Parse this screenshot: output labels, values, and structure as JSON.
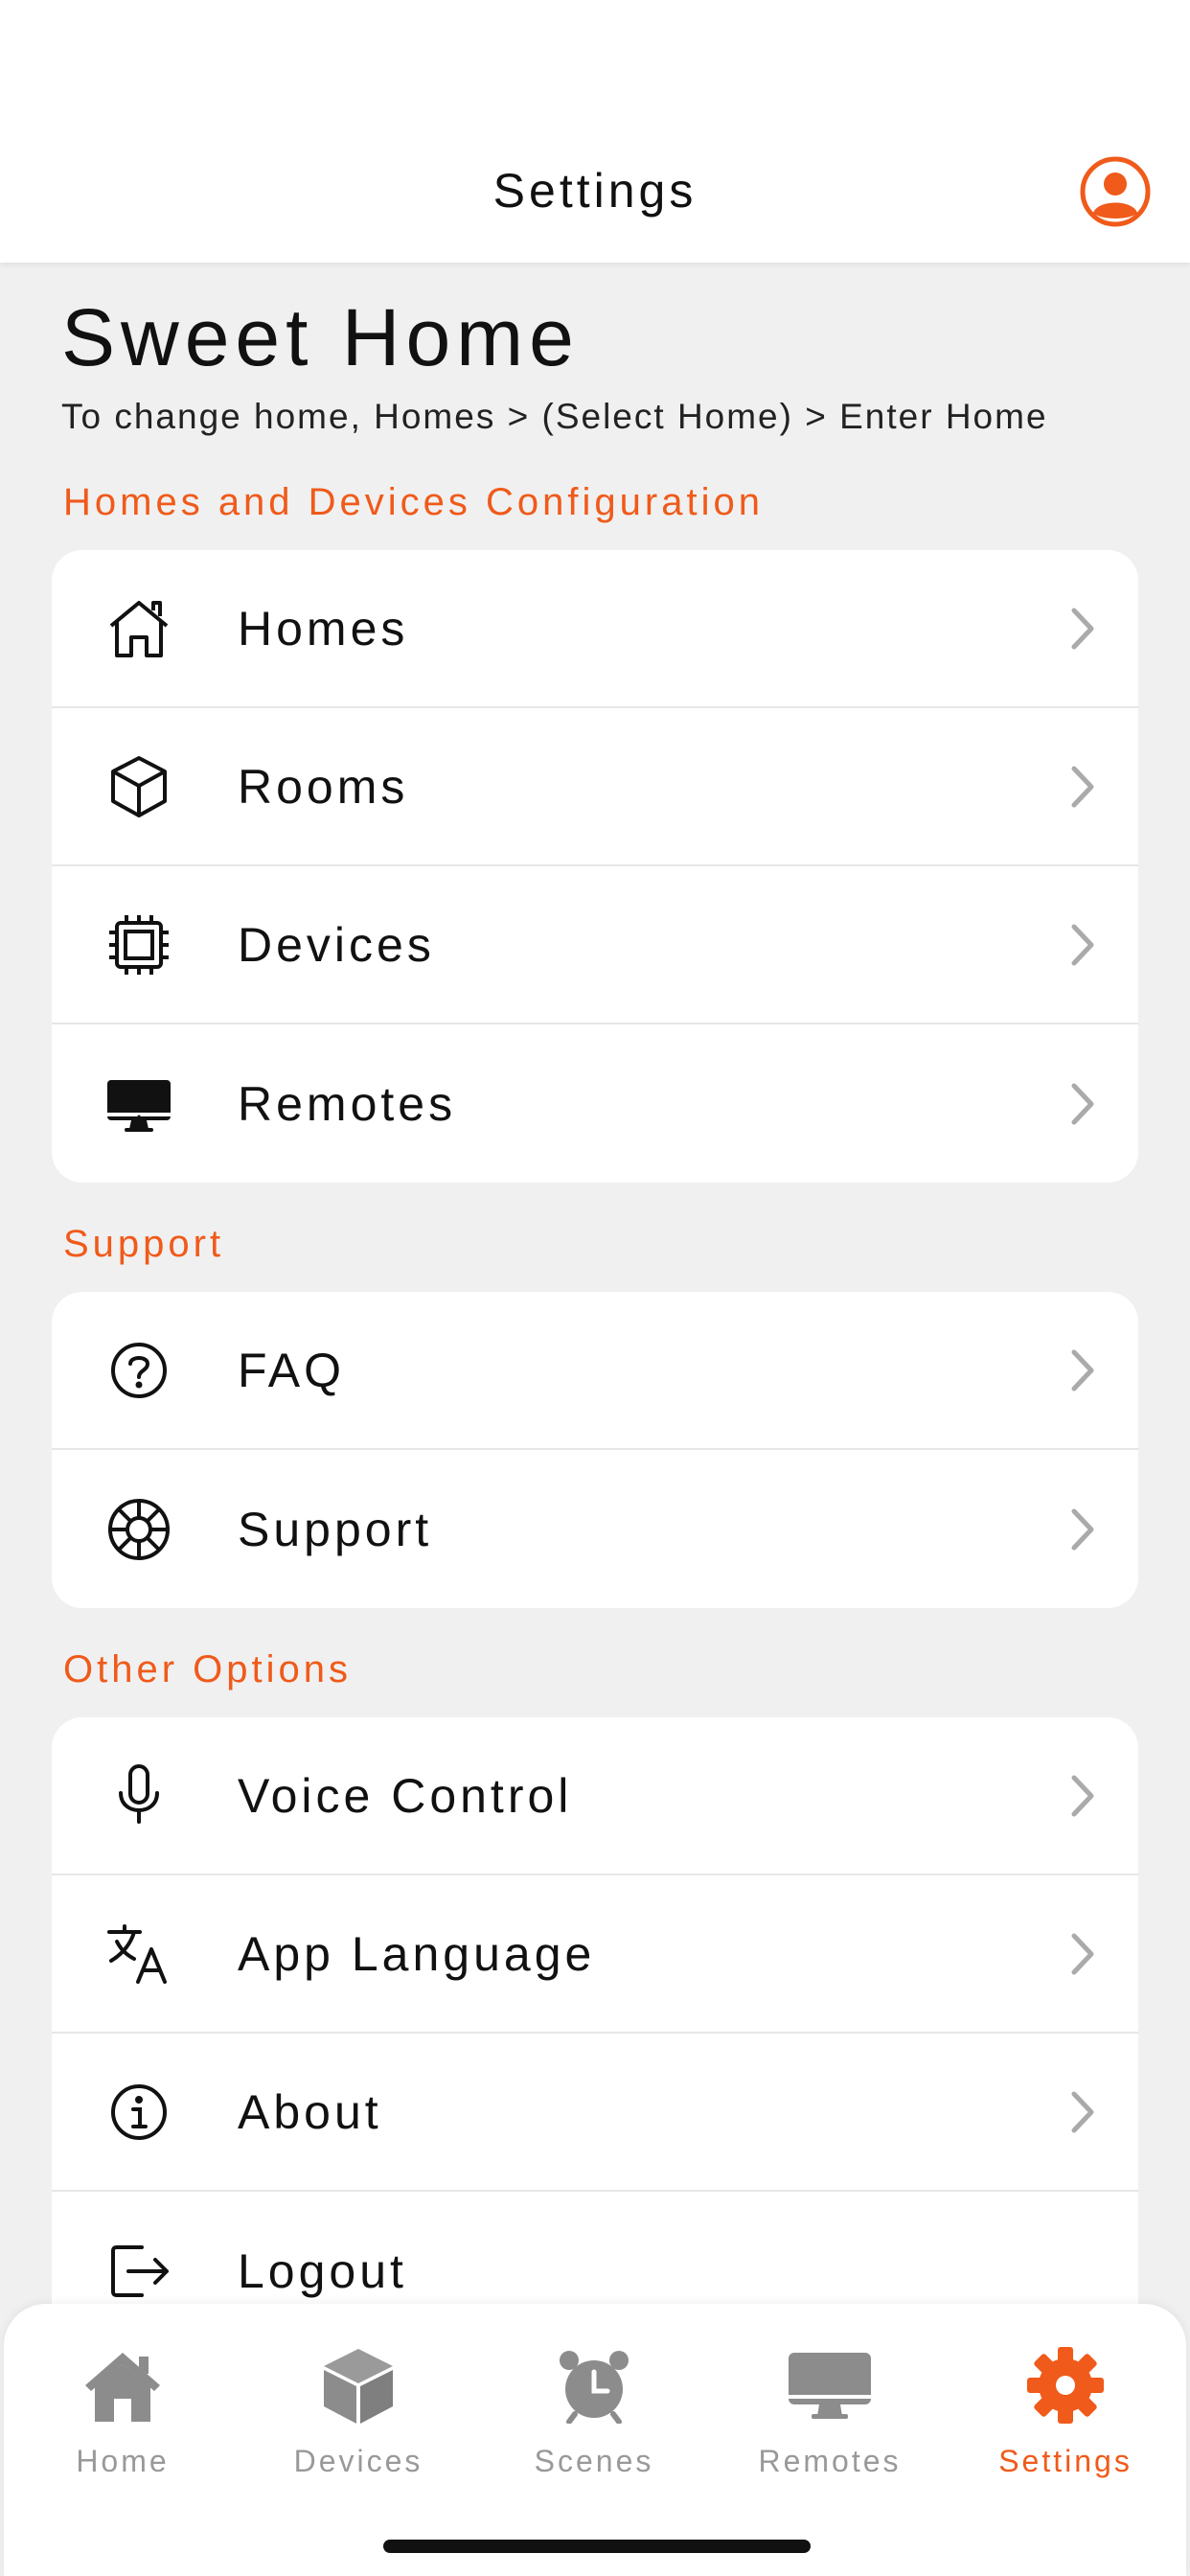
{
  "header": {
    "title": "Settings"
  },
  "home": {
    "name": "Sweet Home",
    "hint": "To change home, Homes > (Select Home) > Enter Home"
  },
  "sections": [
    {
      "label": "Homes and Devices Configuration",
      "items": [
        {
          "label": "Homes",
          "icon": "house-icon"
        },
        {
          "label": "Rooms",
          "icon": "cube-icon"
        },
        {
          "label": "Devices",
          "icon": "chip-icon"
        },
        {
          "label": "Remotes",
          "icon": "monitor-icon"
        }
      ]
    },
    {
      "label": "Support",
      "items": [
        {
          "label": "FAQ",
          "icon": "question-circle-icon"
        },
        {
          "label": "Support",
          "icon": "lifebuoy-icon"
        }
      ]
    },
    {
      "label": "Other Options",
      "items": [
        {
          "label": "Voice Control",
          "icon": "microphone-icon"
        },
        {
          "label": "App Language",
          "icon": "translate-icon"
        },
        {
          "label": "About",
          "icon": "info-circle-icon"
        },
        {
          "label": "Logout",
          "icon": "logout-icon"
        }
      ]
    }
  ],
  "tabs": [
    {
      "label": "Home",
      "icon": "house-filled-icon",
      "active": false
    },
    {
      "label": "Devices",
      "icon": "cube-filled-icon",
      "active": false
    },
    {
      "label": "Scenes",
      "icon": "alarm-clock-icon",
      "active": false
    },
    {
      "label": "Remotes",
      "icon": "monitor-filled-icon",
      "active": false
    },
    {
      "label": "Settings",
      "icon": "gear-icon",
      "active": true
    }
  ],
  "colors": {
    "accent": "#f05a1a",
    "background": "#f0f0f0",
    "card": "#ffffff",
    "tab_inactive": "#999999"
  }
}
